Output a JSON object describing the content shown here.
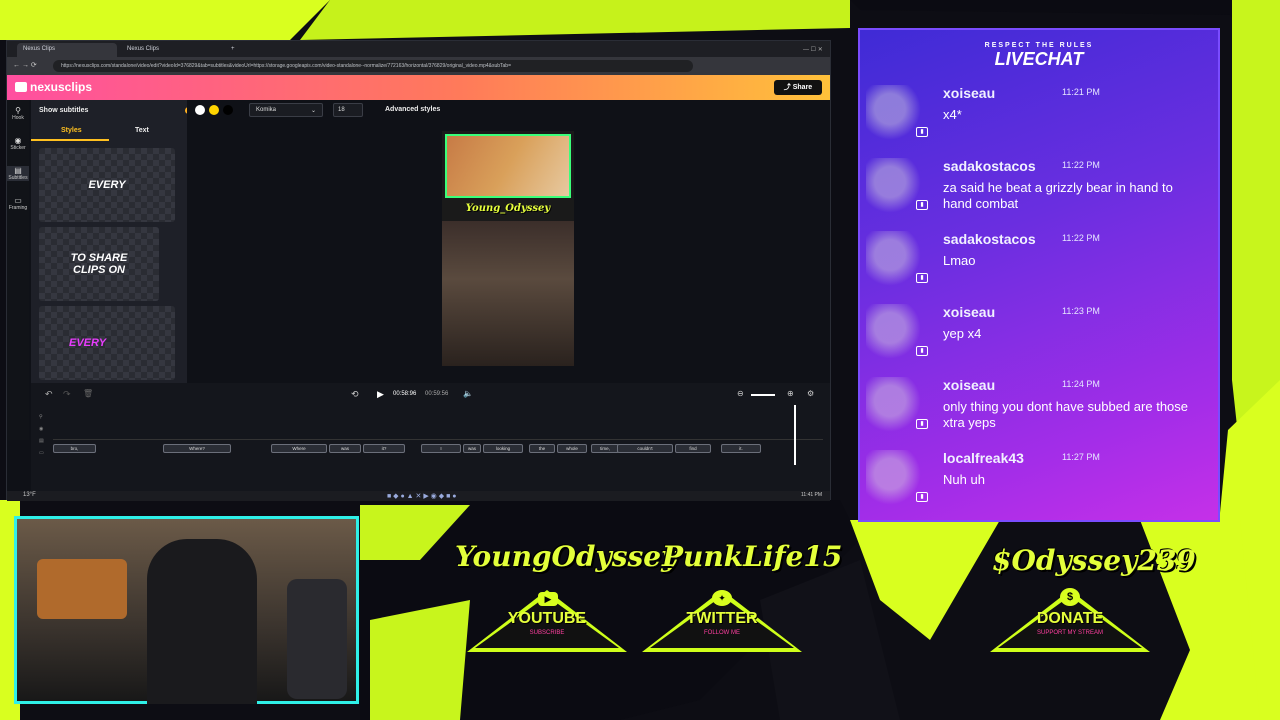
{
  "browser": {
    "tabs": [
      "Nexus Clips",
      "Nexus Clips"
    ],
    "url": "https://nexusclips.com/standalone/video/edit?videoId=376829&tab=subtitles&videoUrl=https://storage.googleapis.com/video-standalone--normalize/772163/horizontal/376829/original_video.mp4&subTab="
  },
  "app": {
    "logo": "nexusclips",
    "share_label": "Share",
    "nav": [
      "Hook",
      "Sticker",
      "Subtitles",
      "Framing"
    ],
    "show_subtitles_label": "Show subtitles",
    "tabs": [
      "Styles",
      "Text"
    ],
    "thumbnails": [
      "EVERY",
      "TO SHARE CLIPS ON",
      "EVERY"
    ],
    "font_value": "Komika",
    "size_value": "18",
    "advanced_label": "Advanced styles",
    "video_name": "Young_Odyssey",
    "time_current": "00:58:96",
    "time_total": "00:59:56",
    "chips": [
      "bro,",
      "Where?",
      "Where",
      "was",
      "it?",
      "I",
      "was",
      "looking",
      "the",
      "whole",
      "time,",
      "couldn't",
      "find",
      "it."
    ]
  },
  "taskbar": {
    "temp": "13°F",
    "clock": "11:41 PM"
  },
  "chat": {
    "kicker": "RESPECT THE RULES",
    "title": "LIVECHAT",
    "messages": [
      {
        "user": "xoiseau",
        "time": "11:21 PM",
        "text": "x4*"
      },
      {
        "user": "sadakostacos",
        "time": "11:22 PM",
        "text": "za said he beat a grizzly bear in hand to hand combat"
      },
      {
        "user": "sadakostacos",
        "time": "11:22 PM",
        "text": "Lmao"
      },
      {
        "user": "xoiseau",
        "time": "11:23 PM",
        "text": "yep x4"
      },
      {
        "user": "xoiseau",
        "time": "11:24 PM",
        "text": "only thing you dont have subbed are those xtra yeps"
      },
      {
        "user": "localfreak43",
        "time": "11:27 PM",
        "text": "Nuh uh"
      }
    ]
  },
  "socials": {
    "youtube_handle": "YoungOdyssey",
    "twitter_handle": "PunkLife15",
    "cashapp_handle": "$Odyssey239",
    "youtube_label": "YOUTUBE",
    "twitter_label": "TWITTER",
    "donate_label": "DONATE",
    "youtube_sub": "SUBSCRIBE",
    "twitter_sub": "FOLLOW ME",
    "donate_sub": "SUPPORT MY STREAM"
  },
  "colors": {
    "accent_yellow": "#d9ff1f",
    "chat_purple": "#6a2ee0",
    "cyan": "#2ff0e8"
  }
}
